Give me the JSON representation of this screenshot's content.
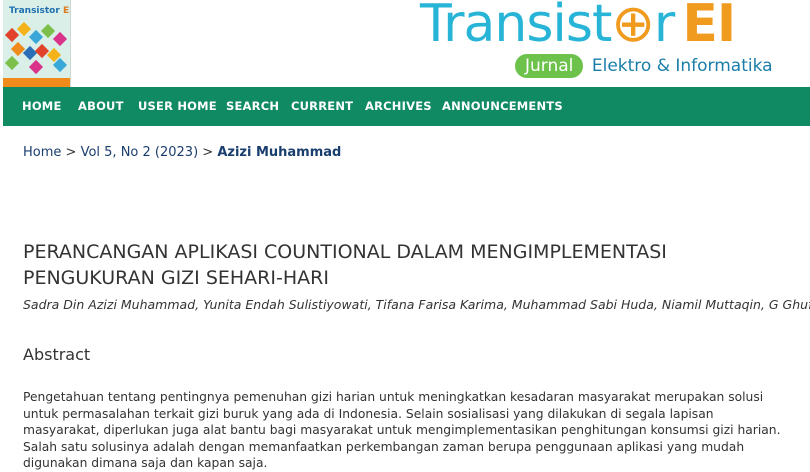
{
  "header": {
    "cover": {
      "title_prefix": "Transistor",
      "title_suffix": "EI"
    },
    "logo": {
      "main_start": "Transist",
      "main_mid": "⊕",
      "main_end": "r",
      "main_ei": "EI",
      "badge": "Jurnal",
      "subtitle": "Elektro & Informatika"
    }
  },
  "nav": {
    "items": [
      {
        "label": "HOME"
      },
      {
        "label": "ABOUT"
      },
      {
        "label": "USER HOME"
      },
      {
        "label": "SEARCH"
      },
      {
        "label": "CURRENT"
      },
      {
        "label": "ARCHIVES"
      },
      {
        "label": "ANNOUNCEMENTS"
      }
    ]
  },
  "breadcrumb": {
    "home": "Home",
    "sep": ">",
    "issue": "Vol 5, No 2 (2023)",
    "current": "Azizi Muhammad"
  },
  "article": {
    "title": "PERANCANGAN APLIKASI COUNTIONAL DALAM MENGIMPLEMENTASI PENGUKURAN GIZI SEHARI-HARI",
    "authors": "Sadra Din Azizi Muhammad, Yunita Endah Sulistiyowati, Tifana Farisa Karima, Muhammad Sabi Huda, Niamil Muttaqin, G Ghufron",
    "abstract_heading": "Abstract",
    "abstract_text": "Pengetahuan tentang pentingnya pemenuhan gizi harian untuk meningkatkan kesadaran masyarakat merupakan solusi untuk permasalahan terkait gizi buruk yang ada di Indonesia. Selain sosialisasi yang dilakukan di segala lapisan masyarakat, diperlukan juga alat bantu bagi masyarakat untuk mengimplementasikan penghitungan konsumsi gizi harian. Salah satu solusinya adalah dengan memanfaatkan perkembangan zaman berupa penggunaan aplikasi yang mudah digunakan dimana saja dan kapan saja."
  },
  "colors": {
    "nav_bg": "#0f8a62",
    "logo_blue": "#27b4d6",
    "logo_orange": "#f09a1e",
    "badge_green": "#6cc24a",
    "link": "#1a3e6e"
  }
}
